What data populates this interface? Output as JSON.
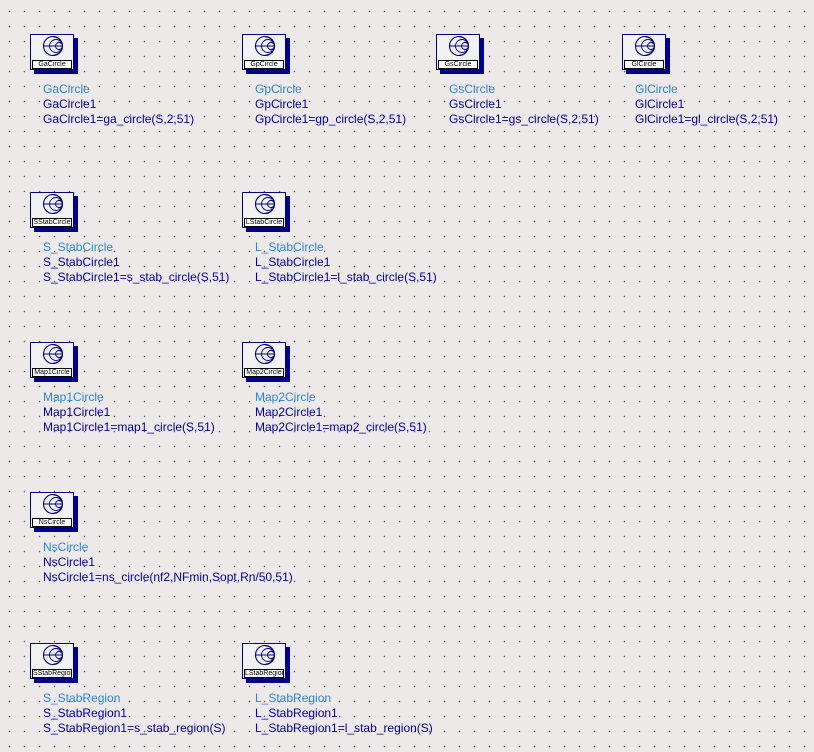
{
  "components": [
    {
      "symbol_label": "GaCircle",
      "type": "GaCircle",
      "instance": "GaCircle1",
      "equation": "GaCircle1=ga_circle(S,2,51)"
    },
    {
      "symbol_label": "GpCircle",
      "type": "GpCircle",
      "instance": "GpCircle1",
      "equation": "GpCircle1=gp_circle(S,2,51)"
    },
    {
      "symbol_label": "GsCircle",
      "type": "GsCircle",
      "instance": "GsCircle1",
      "equation": "GsCircle1=gs_circle(S,2,51)"
    },
    {
      "symbol_label": "GlCircle",
      "type": "GlCircle",
      "instance": "GlCircle1",
      "equation": "GlCircle1=gl_circle(S,2,51)"
    },
    {
      "symbol_label": "SStabCircle",
      "type": "S_StabCircle",
      "instance": "S_StabCircle1",
      "equation": "S_StabCircle1=s_stab_circle(S,51)"
    },
    {
      "symbol_label": "LStabCircle",
      "type": "L_StabCircle",
      "instance": "L_StabCircle1",
      "equation": "L_StabCircle1=l_stab_circle(S,51)"
    },
    {
      "symbol_label": "Map1Circle",
      "type": "Map1Circle",
      "instance": "Map1Circle1",
      "equation": "Map1Circle1=map1_circle(S,51)"
    },
    {
      "symbol_label": "Map2Circle",
      "type": "Map2Circle",
      "instance": "Map2Circle1",
      "equation": "Map2Circle1=map2_circle(S,51)"
    },
    {
      "symbol_label": "NsCircle",
      "type": "NsCircle",
      "instance": "NsCircle1",
      "equation": "NsCircle1=ns_circle(nf2,NFmin,Sopt,Rn/50,51)"
    },
    {
      "symbol_label": "SStabRegion",
      "type": "S_StabRegion",
      "instance": "S_StabRegion1",
      "equation": "S_StabRegion1=s_stab_region(S)"
    },
    {
      "symbol_label": "LStabRegion",
      "type": "L_StabRegion",
      "instance": "L_StabRegion1",
      "equation": "L_StabRegion1=l_stab_region(S)"
    }
  ],
  "colors": {
    "background": "#ECE9E8",
    "type_text": "#2F86D6",
    "instance_text": "#0000A0",
    "symbol_border": "#000080",
    "grid_dot": "#5a5a6a"
  },
  "icon": "smith-chart-icon"
}
